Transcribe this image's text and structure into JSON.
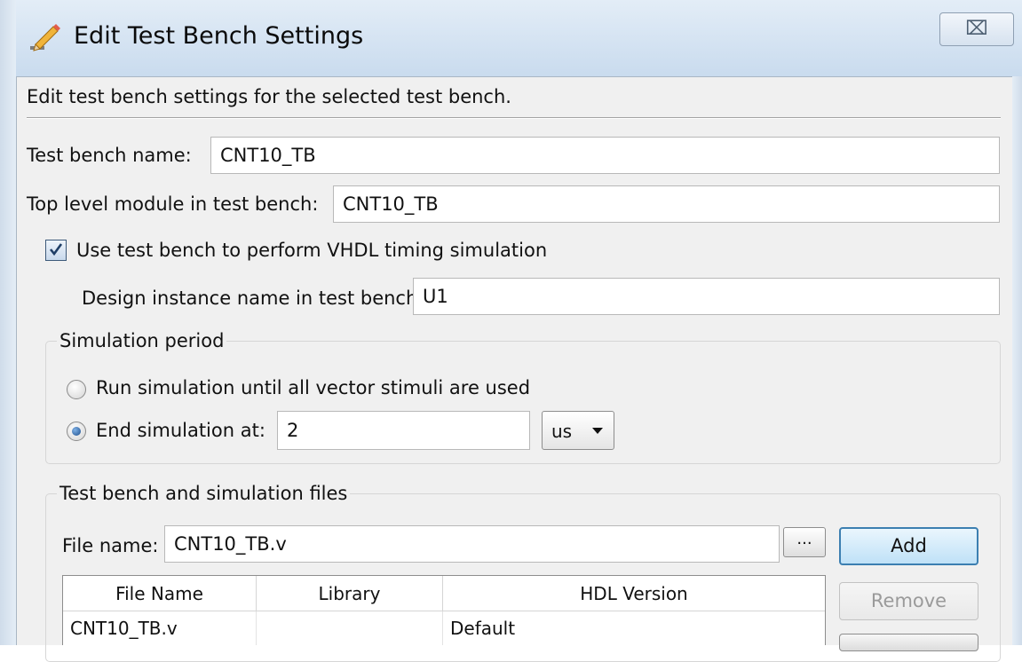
{
  "window": {
    "title": "Edit Test Bench Settings",
    "title_icon": "pencil-settings-icon",
    "close_symbol": "⌧"
  },
  "description": "Edit test bench settings for the selected test bench.",
  "test_bench_name": {
    "label": "Test bench name:",
    "value": "CNT10_TB"
  },
  "top_level_module": {
    "label": "Top level module in test bench:",
    "value": "CNT10_TB"
  },
  "vhdl_timing": {
    "label": "Use test bench to perform VHDL timing simulation",
    "checked": true
  },
  "design_instance": {
    "label": "Design instance name in test bench:",
    "value": "U1"
  },
  "simulation_period": {
    "title": "Simulation period",
    "run_all_label": "Run simulation until all vector stimuli are used",
    "end_at_label": "End simulation at:",
    "end_at_value": "2",
    "unit": "us",
    "selected": "end_at"
  },
  "files_group": {
    "title": "Test bench and simulation files",
    "file_name_label": "File name:",
    "file_name_value": "CNT10_TB.v",
    "browse_label": "...",
    "add_label": "Add",
    "remove_label": "Remove",
    "columns": [
      "File Name",
      "Library",
      "HDL Version"
    ],
    "rows": [
      {
        "file": "CNT10_TB.v",
        "library": "",
        "hdl": "Default"
      }
    ]
  },
  "colors": {
    "accent": "#3c7fb1",
    "dialog_bg": "#f0f0f0",
    "titlebar": "#d4e3f2"
  }
}
